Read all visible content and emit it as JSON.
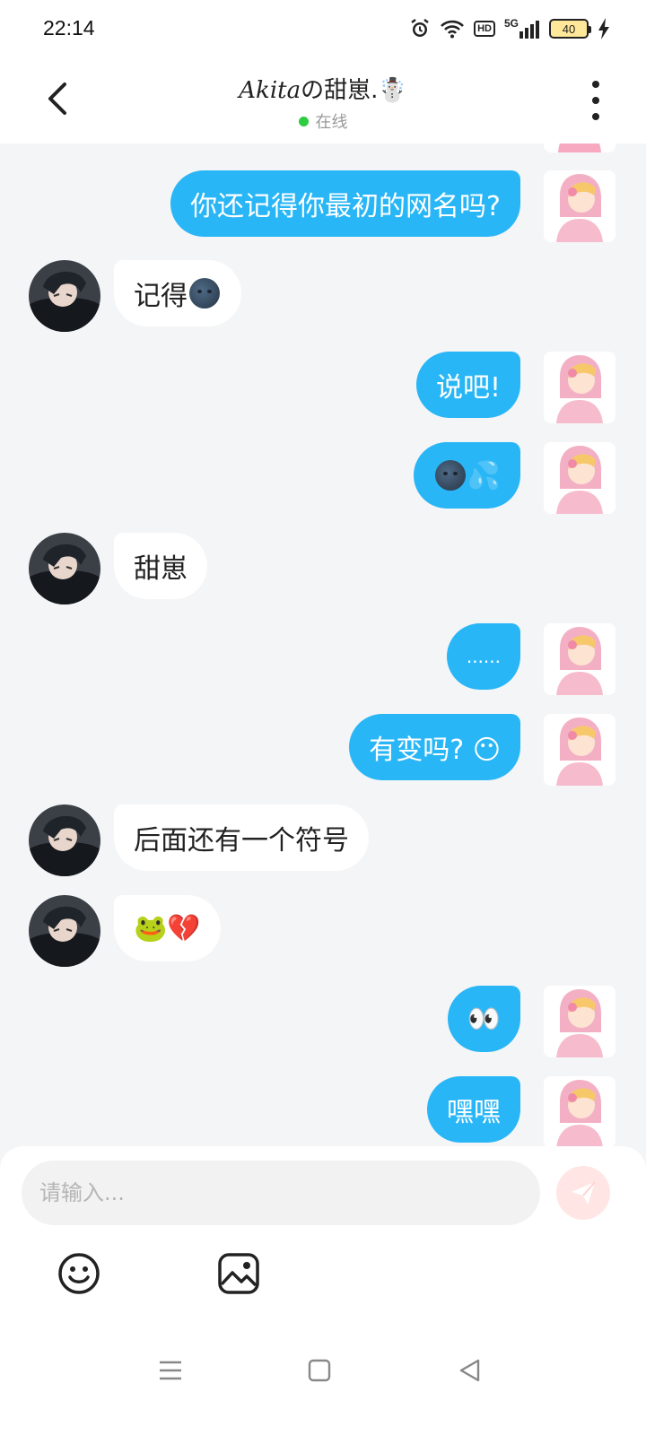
{
  "status_bar": {
    "time": "22:14",
    "hd": "HD",
    "network": "5G",
    "battery": "40"
  },
  "header": {
    "name_italic": "Akita",
    "name_rest": "の甜崽.☃️",
    "status": "在线",
    "online_color": "#2ecc40"
  },
  "messages": [
    {
      "side": "mine",
      "text": "你还记得你最初的网名吗?"
    },
    {
      "side": "other",
      "text": "记得",
      "emoji": "dark-moon-face"
    },
    {
      "side": "mine",
      "text": "说吧!"
    },
    {
      "side": "mine",
      "text": "💦",
      "emoji": "dark-moon-face"
    },
    {
      "side": "other",
      "text": "甜崽"
    },
    {
      "side": "mine",
      "text": "......"
    },
    {
      "side": "mine",
      "text": "有变吗? 😶"
    },
    {
      "side": "other",
      "text": "后面还有一个符号"
    },
    {
      "side": "other",
      "text": "🐸💔"
    },
    {
      "side": "mine",
      "text": "👀"
    },
    {
      "side": "mine",
      "text": "嘿嘿"
    }
  ],
  "input": {
    "placeholder": "请输入...",
    "value": ""
  },
  "toolbar": {
    "emoji_icon": "smiley-icon",
    "image_icon": "image-icon",
    "send_icon": "paper-plane-icon"
  },
  "colors": {
    "my_bubble": "#29b6f6",
    "other_bubble": "#ffffff",
    "background": "#f4f5f7",
    "send_button": "#ffe6e4"
  }
}
